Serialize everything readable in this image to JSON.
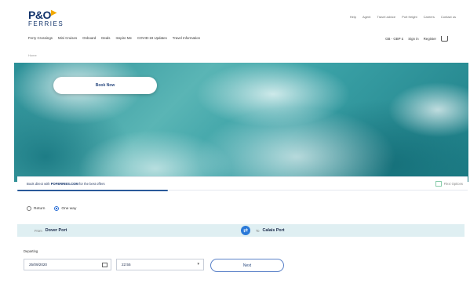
{
  "brand": {
    "logo_top": "P&O",
    "logo_bottom": "FERRIES"
  },
  "utility_nav": [
    "Help",
    "Agent",
    "Travel advice",
    "Port freight",
    "Careers",
    "Contact us"
  ],
  "main_nav": [
    "Ferry Crossings",
    "Mini Cruises",
    "Onboard",
    "Deals",
    "Inspire Me",
    "COVID-19 Updates",
    "Travel Information"
  ],
  "right_nav": {
    "currency": "GB - GBP £",
    "sign_in": "Sign in",
    "register": "Register"
  },
  "breadcrumb": "Home",
  "hero": {
    "book_button": "Book Now"
  },
  "info_bar": {
    "message_prefix": "Book direct with",
    "message_brand": "POFERRIES.COM",
    "message_suffix": "for the best offers",
    "flexi_label": "Flexi Options"
  },
  "trip_type": {
    "return_label": "Return",
    "oneway_label": "One way",
    "selected": "one_way"
  },
  "route": {
    "from_label": "From",
    "from_value": "Dover Port",
    "swap_symbol": "⇄",
    "to_label": "To",
    "to_value": "Calais Port"
  },
  "departing": {
    "label": "Departing",
    "date": "25/09/2020",
    "time": "22:55"
  },
  "next_button": "Next",
  "colors": {
    "brand_navy": "#12336b",
    "accent_blue": "#2a79d8",
    "route_bg": "#dfeff2"
  }
}
